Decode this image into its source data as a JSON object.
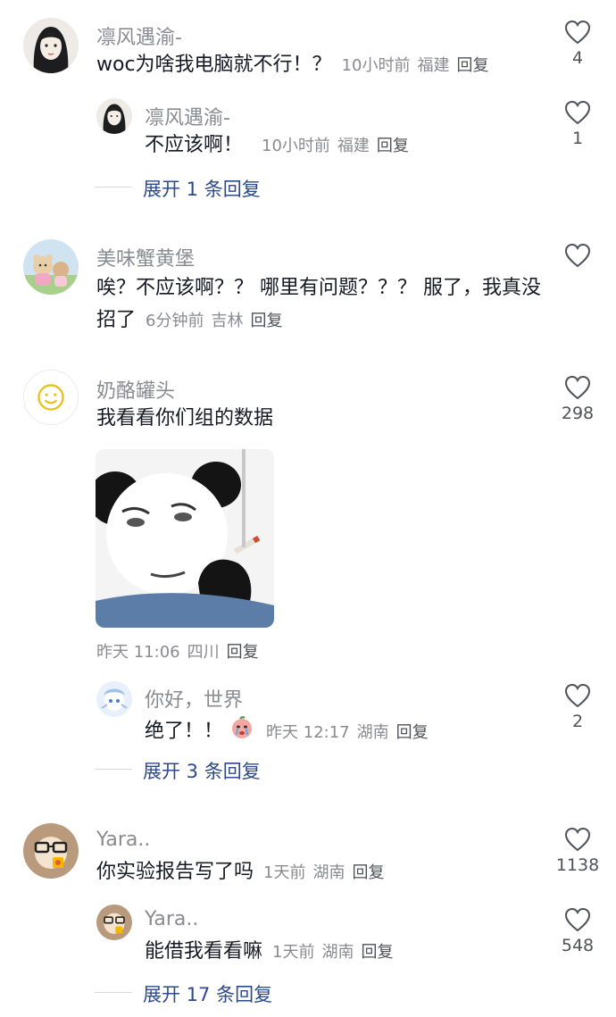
{
  "comments": [
    {
      "user": "凛风遇渝-",
      "text": "woc为啥我电脑就不行！？",
      "time": "10小时前",
      "location": "福建",
      "reply": "回复",
      "likes": "4",
      "replies": [
        {
          "user": "凛风遇渝-",
          "text": "不应该啊！",
          "time": "10小时前",
          "location": "福建",
          "reply": "回复",
          "likes": "1"
        }
      ],
      "expand": "展开 1 条回复"
    },
    {
      "user": "美味蟹黄堡",
      "text_line1": "唉？不应该啊？？ 哪里有问题？？？ 服了，我真没",
      "text_line2": "招了",
      "time": "6分钟前",
      "location": "吉林",
      "reply": "回复",
      "likes": ""
    },
    {
      "user": "奶酪罐头",
      "text": "我看看你们组的数据",
      "time": "昨天 11:06",
      "location": "四川",
      "reply": "回复",
      "likes": "298",
      "replies": [
        {
          "user": "你好，世界",
          "text": "绝了！！",
          "time": "昨天 12:17",
          "location": "湖南",
          "reply": "回复",
          "likes": "2"
        }
      ],
      "expand": "展开 3 条回复"
    },
    {
      "user": "Yara..",
      "text": "你实验报告写了吗",
      "time": "1天前",
      "location": "湖南",
      "reply": "回复",
      "likes": "1138",
      "replies": [
        {
          "user": "Yara..",
          "text": "能借我看看嘛",
          "time": "1天前",
          "location": "湖南",
          "reply": "回复",
          "likes": "548"
        }
      ],
      "expand": "展开 17 条回复"
    }
  ],
  "icons": {
    "like": "heart-outline-icon"
  },
  "colors": {
    "name": "#8a8b91",
    "text": "#161823",
    "expand": "#2c4a8c"
  }
}
